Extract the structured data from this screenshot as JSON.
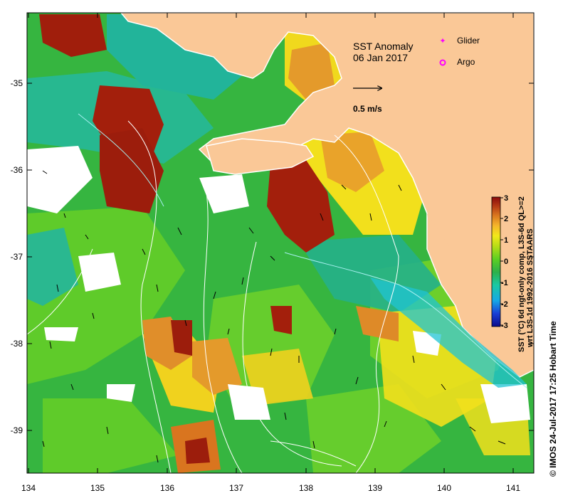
{
  "map": {
    "title": "SST Anomaly",
    "date": "06 Jan 2017",
    "legend": [
      {
        "label": "Glider",
        "color": "#ff00ff",
        "marker": "star"
      },
      {
        "label": "Argo",
        "color": "#ff00ff",
        "marker": "ring"
      }
    ],
    "velocity_scale_label": "0.5 m/s",
    "x_ticks": [
      "134",
      "135",
      "136",
      "137",
      "138",
      "139",
      "140",
      "141"
    ],
    "y_ticks": [
      "-35",
      "-36",
      "-37",
      "-38",
      "-39"
    ],
    "lon_range": [
      134,
      141.3
    ],
    "lat_range": [
      -39.5,
      -34.2
    ]
  },
  "colorbar": {
    "ticks": [
      "3",
      "2",
      "1",
      "0",
      "-1",
      "-2",
      "-3"
    ],
    "range": [
      -3,
      3
    ],
    "label_line1": "SST (°C) 6d ngt-only comp, L3S-6d QL>=2",
    "label_line2": "wrt L3S-1d 1992-2016 SSTAARS",
    "colors": [
      "#0b0b8a",
      "#1a3fd6",
      "#15a8e6",
      "#19c9a3",
      "#2db04a",
      "#5ccf22",
      "#b7dd16",
      "#f2e81a",
      "#f5b52a",
      "#d9751f",
      "#b53a14",
      "#8a0b0b"
    ]
  },
  "credit": "© IMOS 24-Jul-2017 17:25 Hobart Time",
  "palette": {
    "land": "#fac897",
    "green": "#36b540",
    "light_green": "#6fd12a",
    "teal": "#27b890",
    "yellow": "#f2e01c",
    "orange": "#e49a2b",
    "dark_red": "#a31f0c",
    "cyan": "#20c4d4"
  }
}
